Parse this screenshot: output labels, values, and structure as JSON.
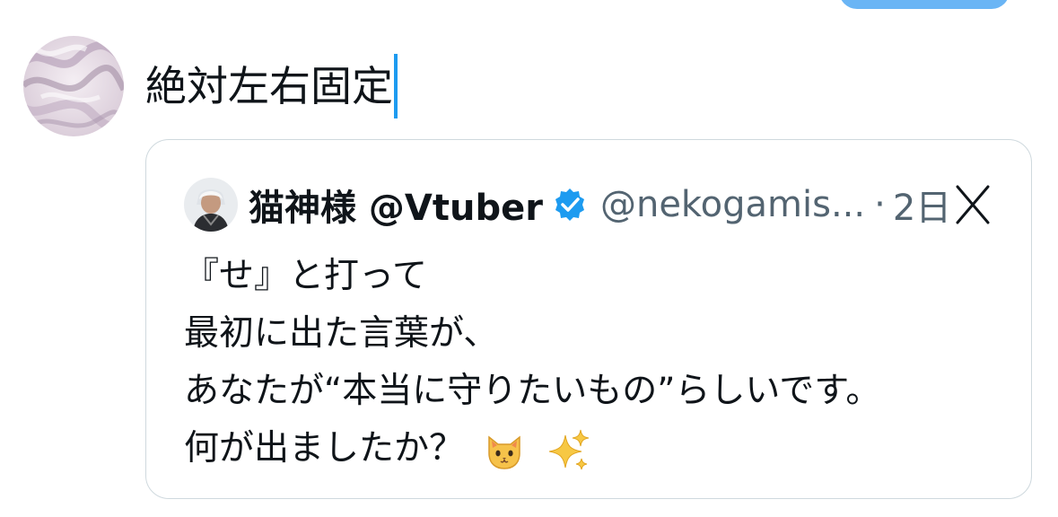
{
  "colors": {
    "accent": "#1d9bf0",
    "post_button": "#6ab5f5",
    "text_primary": "#0f1419",
    "text_secondary": "#536471",
    "card_border": "#cfd9de"
  },
  "composer": {
    "text": "絶対左右固定",
    "avatar_icon": "marbled-avatar-image"
  },
  "quote": {
    "display_name": "猫神様 @Vtuber",
    "verified_icon": "verified-badge-icon",
    "handle": "@nekogamis...",
    "separator": "·",
    "time": "2日",
    "remove_icon": "close-x-icon",
    "lines": [
      "『せ』と打って",
      "最初に出た言葉が、",
      "あなたが“本当に守りたいもの”らしいです。",
      "何が出ましたか？"
    ],
    "trailing_emojis": [
      "cat-face-emoji",
      "sparkles-emoji"
    ]
  }
}
